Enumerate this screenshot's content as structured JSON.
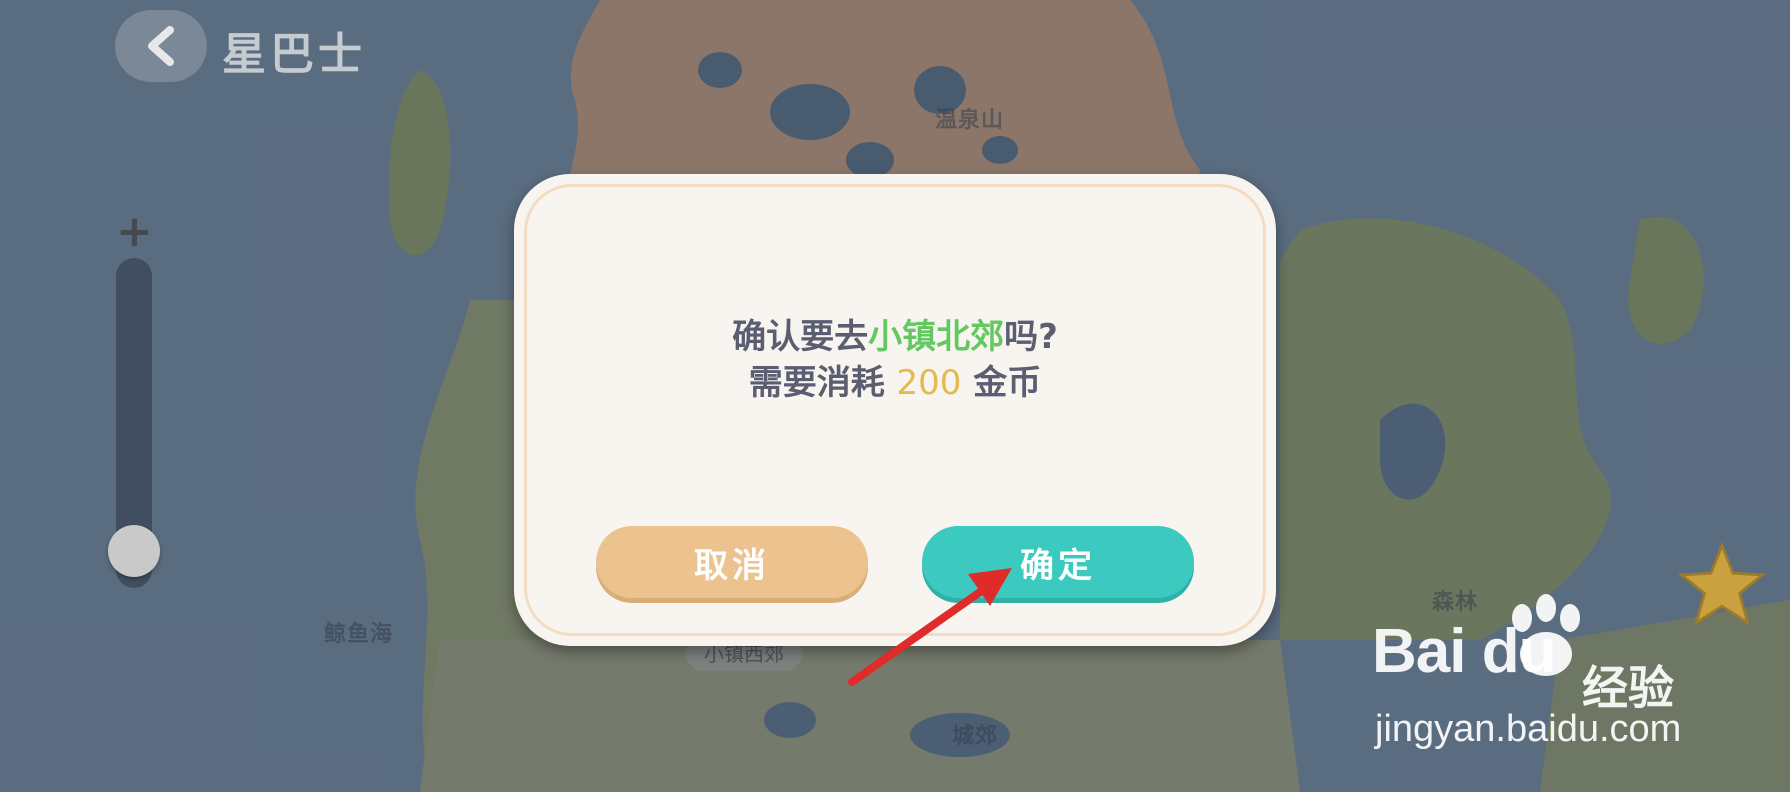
{
  "header": {
    "title": "星巴士",
    "back_icon": "chevron-left-icon"
  },
  "map": {
    "labels": {
      "hot_spring": "温泉山",
      "whale_sea": "鲸鱼海",
      "forest": "森林",
      "suburb": "城郊",
      "west_suburb": "小镇西郊"
    }
  },
  "zoom": {
    "plus_label": "+",
    "level": 0.0
  },
  "dialog": {
    "line1_prefix": "确认要去",
    "destination": "小镇北郊",
    "line1_suffix": "吗?",
    "line2_prefix": "需要消耗 ",
    "cost": "200",
    "line2_suffix": " 金币",
    "cancel_label": "取消",
    "confirm_label": "确定"
  },
  "watermark": {
    "logo_text": "Bai du",
    "jingyan": "经验",
    "url": "jingyan.baidu.com"
  },
  "colors": {
    "destination": "#63c85f",
    "cost": "#e6b84e",
    "cancel_button": "#ecc38e",
    "confirm_button": "#3ccac0",
    "annotation_arrow": "#e02b2b"
  }
}
